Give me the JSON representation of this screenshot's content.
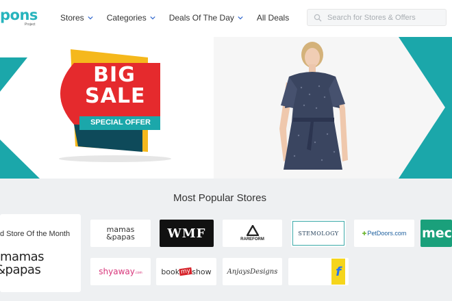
{
  "header": {
    "logo_main": "pons",
    "logo_sub": "Project",
    "nav": [
      {
        "label": "Stores",
        "dropdown": true
      },
      {
        "label": "Categories",
        "dropdown": true
      },
      {
        "label": "Deals Of The Day",
        "dropdown": true
      },
      {
        "label": "All Deals",
        "dropdown": false
      }
    ],
    "search_placeholder": "Search for Stores & Offers"
  },
  "banner": {
    "sale_word1": "BIG",
    "sale_word2": "SALE",
    "sale_offer": "SPECIAL OFFER",
    "slide_count": 3,
    "active_slide": 1,
    "colors": {
      "teal": "#1ba7aa",
      "red": "#e52a2d",
      "yellow": "#f5b81c",
      "dark_teal": "#0e4a5a"
    }
  },
  "popular": {
    "title": "Most Popular Stores",
    "featured_title": "d Store Of the Month",
    "featured_logo_line1": "mamas",
    "featured_logo_line2": "papas",
    "stores_row1": [
      {
        "name": "mamas papas",
        "line1": "mamas",
        "line2": "&papas"
      },
      {
        "name": "WMF",
        "text": "WMF"
      },
      {
        "name": "RAREFORM",
        "text": "RAREFORM"
      },
      {
        "name": "STEMOLOGY",
        "text": "STEMOLOGY"
      },
      {
        "name": "PetDoors.com",
        "text": "PetDoors.com"
      },
      {
        "name": "meci",
        "text": "meci"
      }
    ],
    "stores_row2": [
      {
        "name": "shyaway",
        "text": "shyaway",
        "suffix": ".com"
      },
      {
        "name": "bookmyshow",
        "pre": "book",
        "mid": "my",
        "post": "show"
      },
      {
        "name": "Anjays Designs",
        "text": "AnjaysDesigns"
      },
      {
        "name": "Flipkart",
        "text": "f"
      }
    ]
  }
}
